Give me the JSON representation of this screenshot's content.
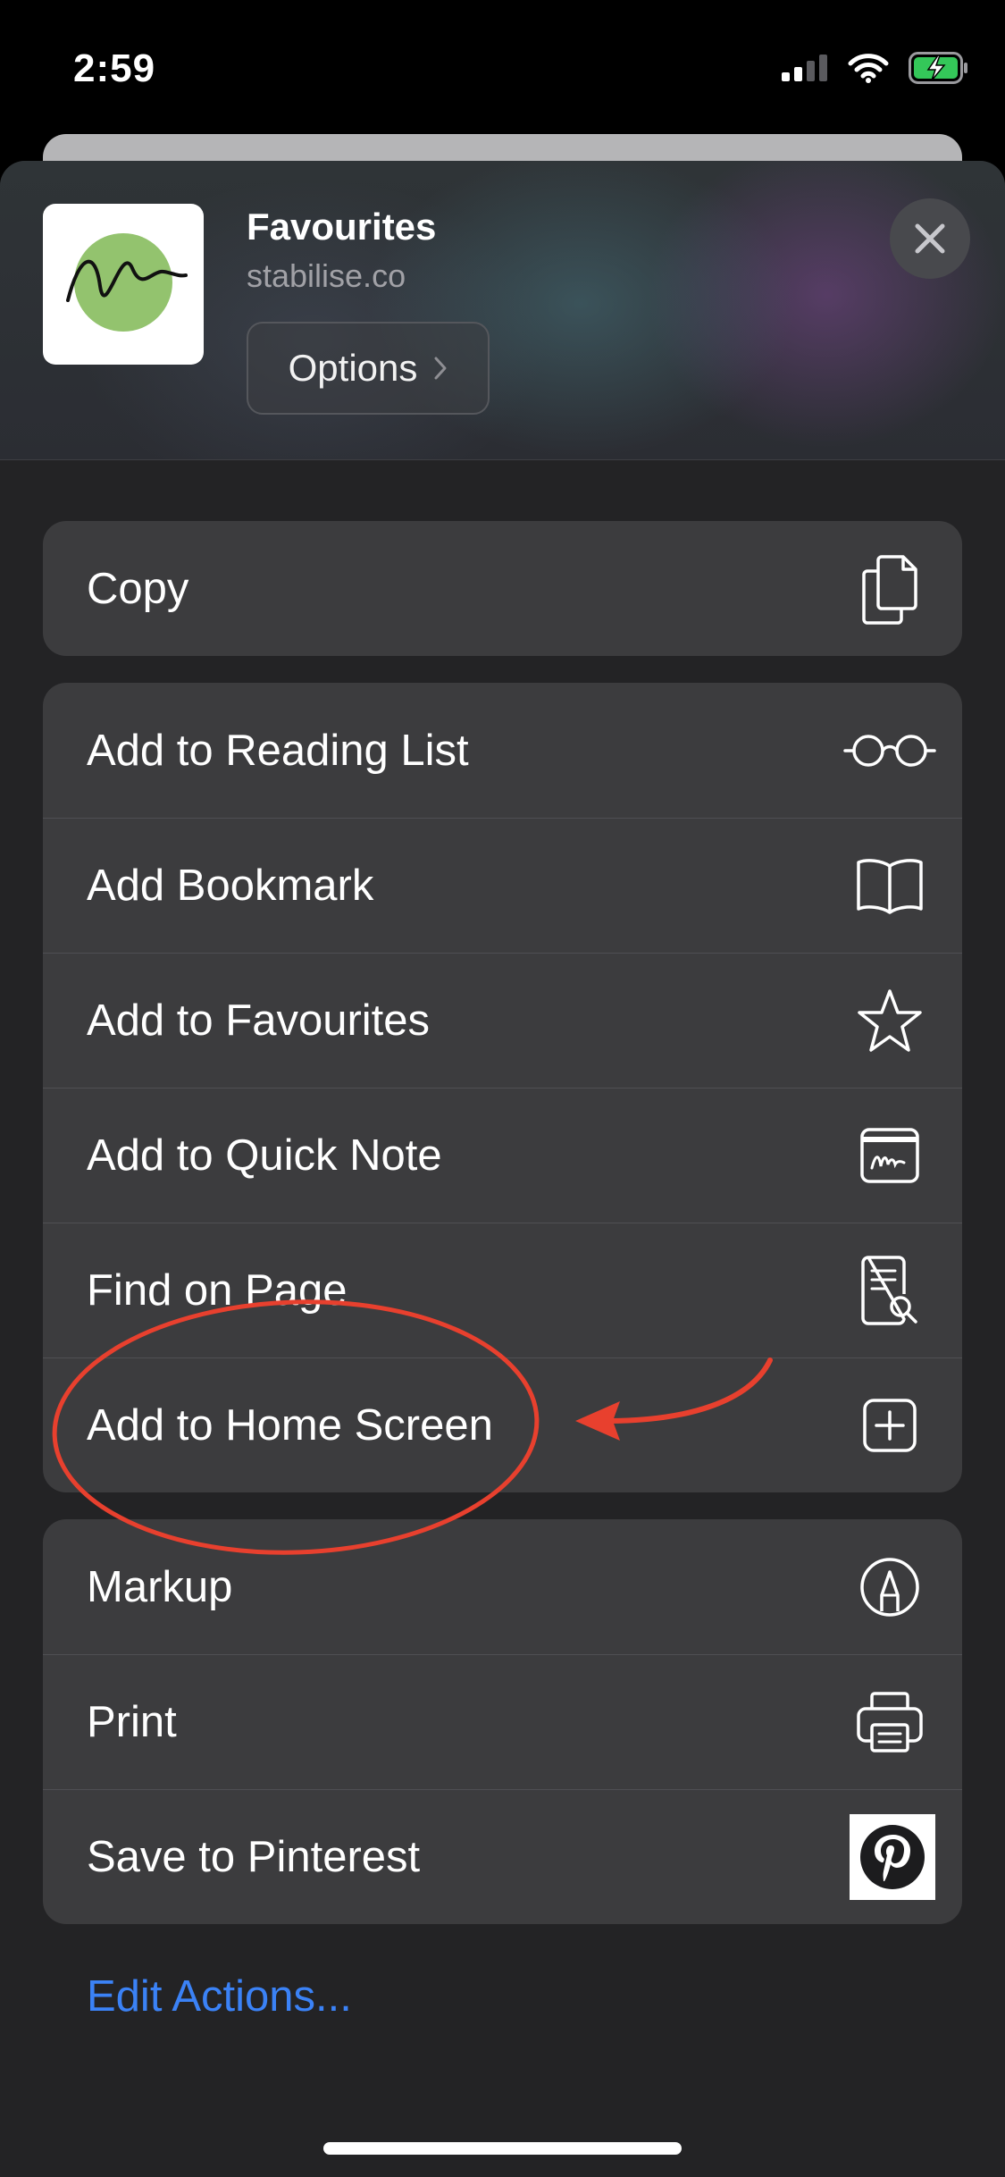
{
  "status_bar": {
    "time": "2:59"
  },
  "header": {
    "title": "Favourites",
    "url": "stabilise.co",
    "options_label": "Options"
  },
  "groups": [
    {
      "items": [
        {
          "label": "Copy",
          "icon": "copy-icon"
        }
      ]
    },
    {
      "items": [
        {
          "label": "Add to Reading List",
          "icon": "glasses-icon"
        },
        {
          "label": "Add Bookmark",
          "icon": "book-icon"
        },
        {
          "label": "Add to Favourites",
          "icon": "star-icon"
        },
        {
          "label": "Add to Quick Note",
          "icon": "quick-note-icon"
        },
        {
          "label": "Find on Page",
          "icon": "find-document-icon"
        },
        {
          "label": "Add to Home Screen",
          "icon": "add-square-icon"
        }
      ]
    },
    {
      "items": [
        {
          "label": "Markup",
          "icon": "markup-pen-icon"
        },
        {
          "label": "Print",
          "icon": "printer-icon"
        },
        {
          "label": "Save to Pinterest",
          "icon": "pinterest-icon"
        }
      ]
    }
  ],
  "edit_actions_label": "Edit Actions...",
  "colors": {
    "accent_link": "#3b82f6",
    "annotation": "#e8402e",
    "row_background": "#3c3c3e",
    "site_icon_circle": "#93c36e"
  }
}
